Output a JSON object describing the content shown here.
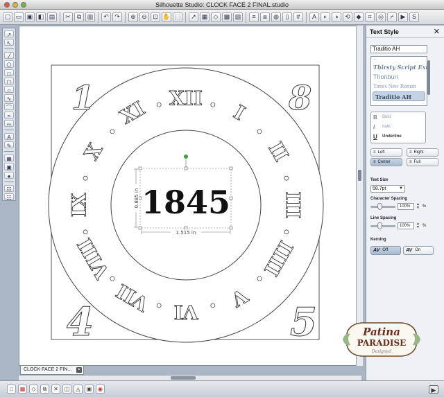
{
  "window": {
    "title": "Silhouette Studio: CLOCK FACE 2 FINAL.studio"
  },
  "toolbar": {
    "icons": [
      "new-document-icon",
      "open-folder-icon",
      "save-icon",
      "library-icon",
      "print-icon",
      "cut-icon",
      "copy-icon",
      "paste-icon",
      "undo-icon",
      "redo-icon",
      "zoom-in-icon",
      "zoom-out-icon",
      "zoom-fit-icon",
      "zoom-hand-icon",
      "fill-page-icon",
      "draw-pointer-icon",
      "select-all-icon",
      "deselect-icon",
      "group-icon",
      "ungroup-icon",
      "align-icon",
      "replicate-icon",
      "nest-icon",
      "page-settings-icon",
      "grid-icon",
      "text-style-icon",
      "fill-color-icon",
      "line-color-icon",
      "transform-icon",
      "point-edit-icon",
      "trace-icon",
      "offset-icon",
      "knife-icon",
      "send-to-silhouette-icon",
      "store-icon"
    ]
  },
  "document": {
    "tab_label": "CLOCK FACE 2 FIN...",
    "selected_text": "1845",
    "dim_width": "1.515 in",
    "dim_height": "0.885 in",
    "outer_numerals": {
      "top_left": "1",
      "top_right": "8",
      "bottom_left": "4",
      "bottom_right": "5"
    },
    "ring_numerals": [
      "XII",
      "I",
      "II",
      "III",
      "IIII",
      "V",
      "VI",
      "VII",
      "VIII",
      "IX",
      "X",
      "XI"
    ]
  },
  "text_style_panel": {
    "title": "Text Style",
    "font_value": "Traditio AH",
    "font_list": [
      "Thirsty Script Extrab",
      "Thonburi",
      "Times New Roman",
      "Traditio AH"
    ],
    "styles": [
      {
        "glyph": "B",
        "label": "Bold"
      },
      {
        "glyph": "I",
        "label": "Italic"
      },
      {
        "glyph": "U",
        "label": "Underline"
      }
    ],
    "align": [
      {
        "label": "Left",
        "active": false
      },
      {
        "label": "Right",
        "active": false
      },
      {
        "label": "Center",
        "active": true
      },
      {
        "label": "Full",
        "active": false
      }
    ],
    "text_size_label": "Text Size",
    "text_size": "58.7pt",
    "char_spacing_label": "Character Spacing",
    "char_spacing": "100%",
    "line_spacing_label": "Line Spacing",
    "line_spacing": "100%",
    "percent_sign": "%",
    "kerning_label": "Kerning",
    "kerning_off": "Off",
    "kerning_on": "On",
    "kerning_glyph": "AV"
  },
  "logo": {
    "line1": "Patina",
    "line2": "PARADISE",
    "line3": "Designed"
  }
}
